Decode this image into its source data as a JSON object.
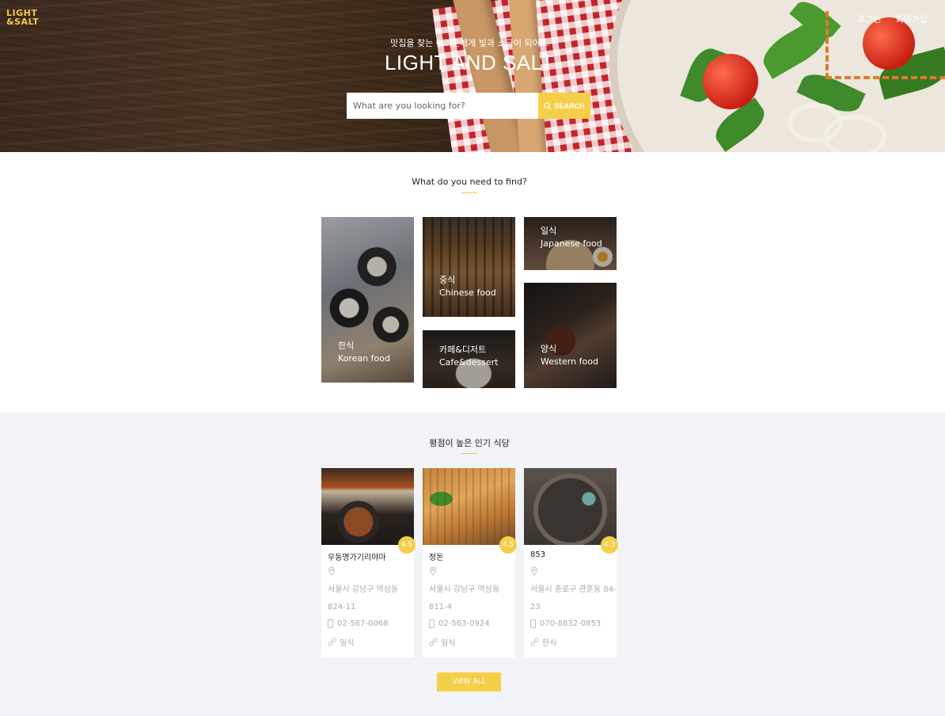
{
  "header": {
    "logo_line1": "LIGHT",
    "logo_line2": "&SALT",
    "nav": {
      "login": "로그인",
      "signup": "회원가입"
    },
    "tagline": "맛집을 찾는 여러분에게 빛과 소금이 되어드",
    "title": "LIGHT AND SALT",
    "search": {
      "placeholder": "What are you looking for?",
      "button_label": "SEARCH"
    }
  },
  "find_section": {
    "title": "What do you need to find?",
    "categories": [
      {
        "ko": "한식",
        "en": "Korean food"
      },
      {
        "ko": "중식",
        "en": "Chinese food"
      },
      {
        "ko": "카페&디저트",
        "en": "Cafe&dessert"
      },
      {
        "ko": "일식",
        "en": "Japanese food"
      },
      {
        "ko": "양식",
        "en": "Western food"
      }
    ]
  },
  "popular_section": {
    "title": "평점이 높은 인기 식당",
    "restaurants": [
      {
        "name": "우동명가기리야마",
        "rating": "4.5",
        "address": "서울시 강남구 역삼동 824-11",
        "phone": "02-567-0068",
        "cuisine": "일식"
      },
      {
        "name": "정돈",
        "rating": "4.5",
        "address": "서울시 강남구 역삼동 811-4",
        "phone": "02-563-0924",
        "cuisine": "일식"
      },
      {
        "name": "853",
        "rating": "4.3",
        "address": "서울시 종로구 관훈동 84-23",
        "phone": "070-8832-0853",
        "cuisine": "한식"
      }
    ],
    "view_all_label": "VIEW ALL"
  },
  "colors": {
    "accent": "#f5cf48",
    "highlight_dash": "#e07a2c",
    "section_bg": "#f2f3f7"
  }
}
